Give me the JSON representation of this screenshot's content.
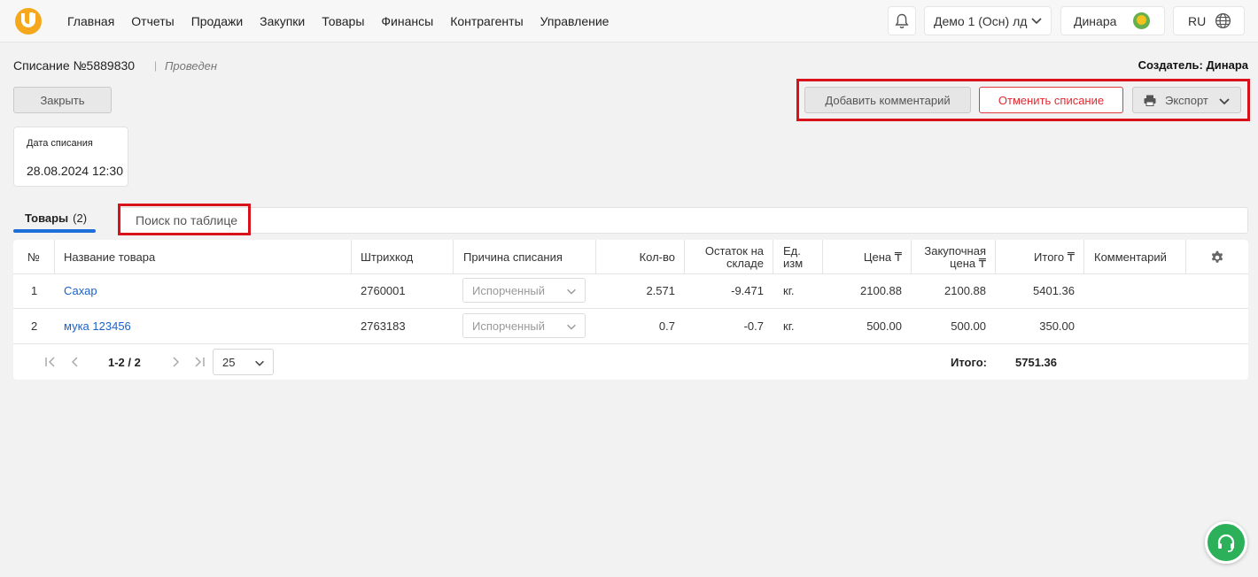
{
  "nav": {
    "items": [
      "Главная",
      "Отчеты",
      "Продажи",
      "Закупки",
      "Товары",
      "Финансы",
      "Контрагенты",
      "Управление"
    ],
    "company": "Демо 1 (Осн) лд",
    "user": "Динара",
    "language": "RU"
  },
  "document": {
    "title": "Списание №5889830",
    "separator": "|",
    "status": "Проведен",
    "creator_label": "Создатель:",
    "creator_name": "Динара"
  },
  "buttons": {
    "close": "Закрыть",
    "add_comment": "Добавить комментарий",
    "cancel_writeoff": "Отменить списание",
    "export": "Экспорт"
  },
  "date_card": {
    "label": "Дата списания",
    "value": "28.08.2024 12:30"
  },
  "tabs": {
    "products_label": "Товары",
    "products_count": "(2)"
  },
  "search": {
    "placeholder": "Поиск по таблице"
  },
  "table": {
    "headers": {
      "num": "№",
      "name": "Название товара",
      "barcode": "Штрихкод",
      "reason": "Причина списания",
      "qty": "Кол-во",
      "stock_1": "Остаток на",
      "stock_2": "складе",
      "unit_1": "Ед.",
      "unit_2": "изм",
      "price": "Цена ₸",
      "purchase_1": "Закупочная",
      "purchase_2": "цена ₸",
      "total": "Итого ₸",
      "comment": "Комментарий"
    },
    "rows": [
      {
        "num": "1",
        "name": "Сахар",
        "barcode": "2760001",
        "reason": "Испорченный",
        "qty": "2.571",
        "stock": "-9.471",
        "unit": "кг.",
        "price": "2100.88",
        "purchase_price": "2100.88",
        "total": "5401.36",
        "comment": ""
      },
      {
        "num": "2",
        "name": "мука 123456",
        "barcode": "2763183",
        "reason": "Испорченный",
        "qty": "0.7",
        "stock": "-0.7",
        "unit": "кг.",
        "price": "500.00",
        "purchase_price": "500.00",
        "total": "350.00",
        "comment": ""
      }
    ]
  },
  "pager": {
    "range": "1-2 / 2",
    "page_size": "25",
    "total_label": "Итого:",
    "total_value": "5751.36"
  },
  "colors": {
    "accent_blue": "#1e6fd9",
    "danger_red": "#e02a30",
    "highlight_red": "#d9111b",
    "logo_orange": "#f5a81c",
    "support_green": "#2db05a"
  },
  "icons": [
    "bell-icon",
    "chevron-down-icon",
    "avatar",
    "globe-icon",
    "printer-icon",
    "gear-icon",
    "first-page-icon",
    "prev-page-icon",
    "next-page-icon",
    "last-page-icon",
    "headset-icon"
  ]
}
